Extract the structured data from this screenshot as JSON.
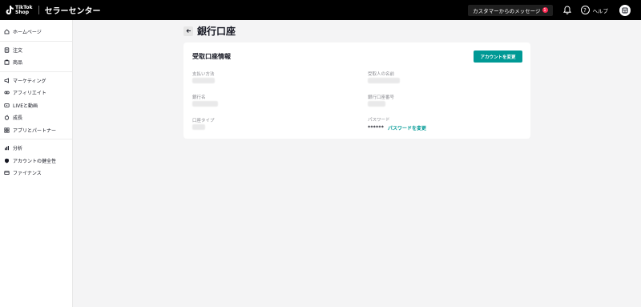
{
  "header": {
    "logo_line1": "TikTok",
    "logo_line2": "Shop",
    "title": "セラーセンター",
    "messages_label": "カスタマーからのメッセージ",
    "messages_count": "1",
    "help_label": "ヘルプ"
  },
  "sidebar": {
    "groups": [
      [
        {
          "label": "ホームページ",
          "icon": "home-icon"
        }
      ],
      [
        {
          "label": "注文",
          "icon": "order-icon"
        },
        {
          "label": "商品",
          "icon": "product-icon"
        }
      ],
      [
        {
          "label": "マーケティング",
          "icon": "megaphone-icon"
        },
        {
          "label": "アフィリエイト",
          "icon": "affiliate-icon"
        },
        {
          "label": "LIVEと動画",
          "icon": "video-icon"
        },
        {
          "label": "成長",
          "icon": "growth-icon"
        },
        {
          "label": "アプリとパートナー",
          "icon": "apps-icon"
        }
      ],
      [
        {
          "label": "分析",
          "icon": "chart-icon"
        },
        {
          "label": "アカウントの健全性",
          "icon": "shield-icon"
        },
        {
          "label": "ファイナンス",
          "icon": "wallet-icon"
        }
      ]
    ]
  },
  "page": {
    "title": "銀行口座",
    "card_title": "受取口座情報",
    "change_button": "アカウントを変更",
    "fields": {
      "payment_method": "支払い方法",
      "payee_name": "受取人の名前",
      "bank_name": "銀行名",
      "account_number": "銀行口座番号",
      "account_type": "口座タイプ",
      "password": "パスワード"
    },
    "password_mask": "******",
    "password_change_link": "パスワードを変更"
  },
  "colors": {
    "accent": "#009995",
    "badge": "#fe2c55",
    "topbar": "#000000"
  }
}
